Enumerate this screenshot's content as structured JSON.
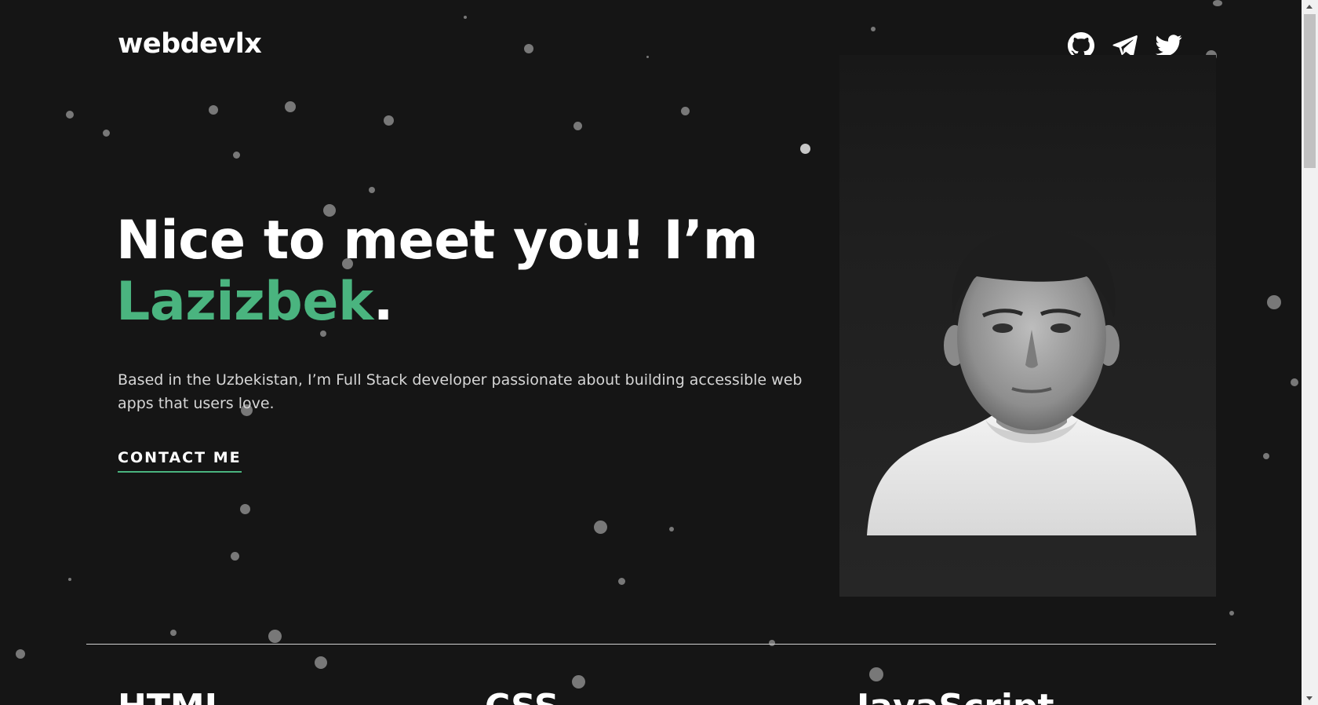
{
  "header": {
    "logo": "webdevlx",
    "social": [
      {
        "icon": "github-icon"
      },
      {
        "icon": "telegram-icon"
      },
      {
        "icon": "twitter-icon"
      }
    ]
  },
  "hero": {
    "title_line1": "Nice to meet you! I’m",
    "name": "Lazizbek",
    "name_suffix": ".",
    "intro": "Based in the Uzbekistan, I’m Full Stack developer passionate about building accessible web apps that users love.",
    "contact_label": "CONTACT ME"
  },
  "photo": {
    "description_icon": "profile-photo"
  },
  "skills": [
    "HTML",
    "CSS",
    "JavaScript"
  ],
  "colors": {
    "background": "#151515",
    "accent": "#4ab47f",
    "text": "#ffffff",
    "muted_text": "#d6d6d6"
  }
}
